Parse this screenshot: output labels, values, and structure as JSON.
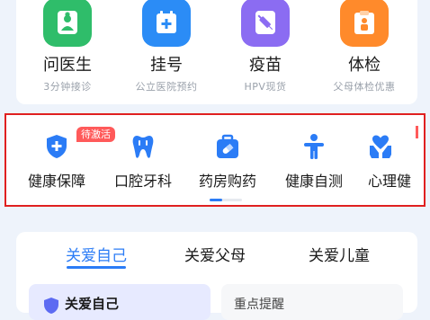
{
  "services": [
    {
      "title": "问医生",
      "subtitle": "3分钟接诊",
      "icon": "doctor-icon",
      "color": "#2fbd6a"
    },
    {
      "title": "挂号",
      "subtitle": "公立医院预约",
      "icon": "calendar-plus-icon",
      "color": "#2b8cf6"
    },
    {
      "title": "疫苗",
      "subtitle": "HPV现货",
      "icon": "syringe-icon",
      "color": "#8b6cf2"
    },
    {
      "title": "体检",
      "subtitle": "父母体检优惠",
      "icon": "checkup-icon",
      "color": "#ff8a2b"
    }
  ],
  "quick_entries": [
    {
      "label": "健康保障",
      "icon": "shield-plus-icon",
      "badge": "待激活"
    },
    {
      "label": "口腔牙科",
      "icon": "tooth-icon"
    },
    {
      "label": "药房购药",
      "icon": "medicine-box-icon"
    },
    {
      "label": "健康自测",
      "icon": "person-icon"
    },
    {
      "label": "心理健",
      "icon": "heart-hands-icon"
    }
  ],
  "care_tabs": [
    {
      "label": "关爱自己",
      "active": true
    },
    {
      "label": "关爱父母",
      "active": false
    },
    {
      "label": "关爱儿童",
      "active": false
    }
  ],
  "care_cards": [
    {
      "label": "关爱自己"
    },
    {
      "label": "重点提醒"
    }
  ],
  "colors": {
    "accent": "#2b7cf6",
    "highlight_border": "#e02020",
    "badge": "#ff5a5a"
  }
}
